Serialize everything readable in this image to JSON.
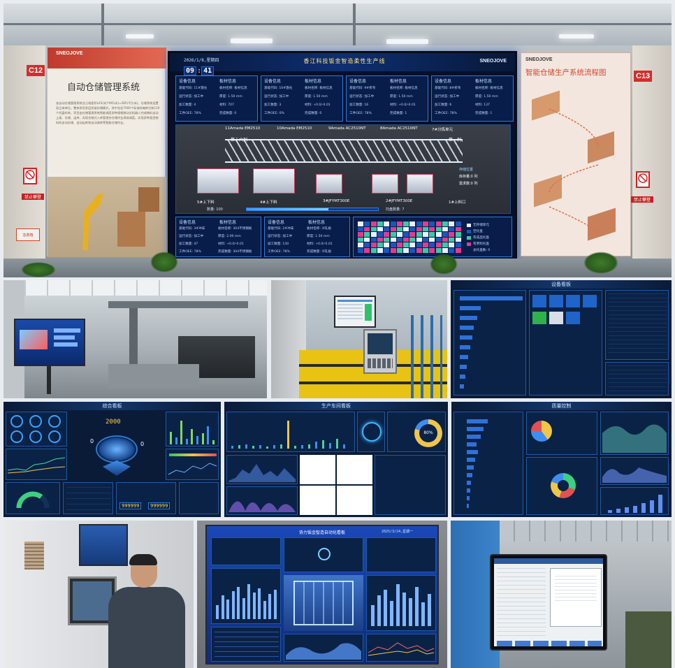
{
  "top_photo": {
    "badge_left": "C12",
    "badge_right": "C13",
    "brand_left": "SNEOJOVE",
    "brand_right": "SNEOJOVE",
    "left_poster_title": "自动仓储管理系统",
    "left_poster_body": "该自动仓储管理系统总占地面积L45(米)*W5(米)=585(平方米)。仓储系统设置双立体库位。整体采用多层货架存储模式，其中包含7000个标准料箱库位和120个托盘料库。项目由仓储管理系统智能调度多种规格移动式机器人完成物料自动上架、仓储、出库，实现仓储式入库管理合仓储作业高效调度。实现多种类型物料的自动存储、自动出库和自动调库等智能仓储作业。",
    "right_poster_title": "智能仓储生产系统流程图",
    "sign_text": "禁止攀登",
    "sign_text_2": "禁止攀登",
    "lower_sign": "急救箱",
    "board": {
      "date": "2026/1/8,星期四",
      "clock_h": "09",
      "clock_m": "41",
      "title": "香江科技钣金智造柔性生产线",
      "logo": "SNEOJOVE",
      "machines": [
        "11Amada EM2510",
        "10Amada EM2510",
        "9Amada AC2510NT",
        "8Amada AC2510NT",
        "7#分拣单元"
      ],
      "machines_bottom": [
        "5#上下料",
        "4#上下料",
        "3#JFYMT300E",
        "2#JFYMT300E",
        "1#上料口"
      ],
      "tower_labels": [
        "第十六列",
        "第一列"
      ],
      "progress_label": "数量: 100",
      "tray_label": "托盘数量: 7",
      "status_title": "料仓信息",
      "status_lines": [
        "存储位置",
        "库存量:0 列",
        "需求数:0 列"
      ],
      "panels_top": [
        {
          "h1": "设备信息",
          "h2": "板材信息",
          "lines": [
            "基础代码: 11#激光",
            "运行状态: 加工中",
            "加工数量: 4",
            "工件OEE: 78%"
          ],
          "lines2": [
            "板材名称: 板材信息",
            "厚度: 1.50 mm",
            "材料: 707",
            "完成数量: 0"
          ]
        },
        {
          "h1": "设备信息",
          "h2": "板材信息",
          "lines": [
            "基础代码: 10#激光",
            "运行状态: 加工中",
            "加工数量: 3",
            "工件OEE: 0%"
          ],
          "lines2": [
            "板材名称: 板材信息",
            "厚度: 1.50 mm",
            "材料: +0.0/-0.01",
            "完成数量: 0"
          ]
        },
        {
          "h1": "设备信息",
          "h2": "板材信息",
          "lines": [
            "基础代码: 9#折弯",
            "运行状态: 加工中",
            "加工数量: 16",
            "工件OEE: 78%"
          ],
          "lines2": [
            "板材名称: 板材信息",
            "厚度: 1.50 mm",
            "材料: +0.0/-0.01",
            "完成数量: 1"
          ]
        },
        {
          "h1": "设备信息",
          "h2": "板材信息",
          "lines": [
            "基础代码: 8#折弯",
            "运行状态: 加工中",
            "加工数量: 6",
            "工件OEE: 78%"
          ],
          "lines2": [
            "板材名称: 板材信息",
            "厚度: 1.50 mm",
            "材料: 137",
            "完成数量: 1"
          ]
        }
      ],
      "panels_bottom": [
        {
          "h1": "设备信息",
          "h2": "板材信息",
          "lines": [
            "基础代码: 3#冲床",
            "运行状态: 加工中",
            "加工数量: 47",
            "工件OEE: 78%"
          ],
          "lines2": [
            "板材名称: 304不锈钢板",
            "厚度: 2.00 mm",
            "材料: +0.0/-0.01",
            "完成数量: 304不锈钢板"
          ]
        },
        {
          "h1": "设备信息",
          "h2": "板材信息",
          "lines": [
            "基础代码: 2#冲床",
            "运行状态: 加工中",
            "加工数量: 130",
            "工件OEE: 78%"
          ],
          "lines2": [
            "板材名称: 冷轧板",
            "厚度: 1.50 mm",
            "材料: +0.0/-0.01",
            "完成数量: 冷轧板"
          ]
        }
      ],
      "legend": [
        "无存储单元",
        "空托盘",
        "有成品托盘",
        "有原料托盘",
        "总托盘数: 0"
      ]
    }
  },
  "dashboards": {
    "device_title": "设备看板",
    "overview_title": "综合看板",
    "production_title": "生产车间看板",
    "quality_title": "质量控制",
    "overview_big_number": "2000",
    "overview_zero": "0",
    "overview_counter_1": "999999",
    "overview_counter_2": "999999",
    "production_gauge": "80%",
    "bottom_board_title": "协力钣金智造自动化看板",
    "bottom_board_date": "2025/3/24,星期一"
  }
}
